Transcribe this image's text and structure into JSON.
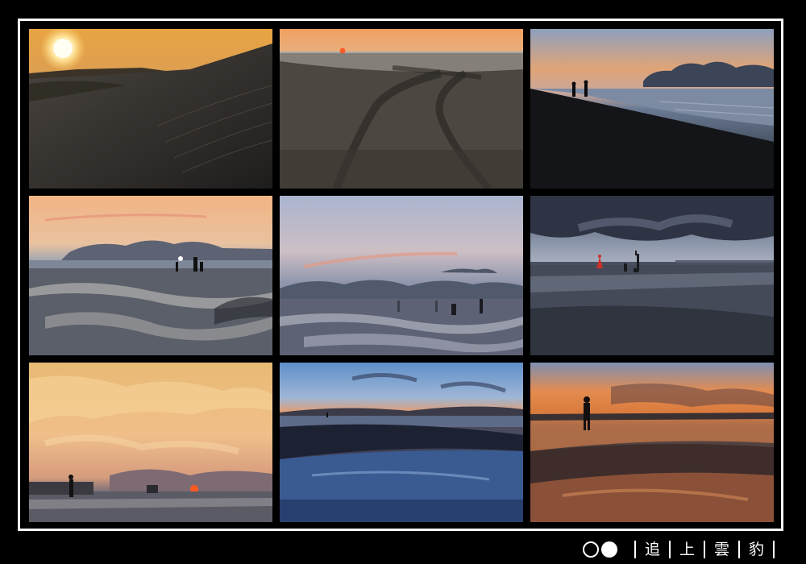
{
  "signature": {
    "chars": [
      "追",
      "上",
      "雲",
      "豹"
    ]
  },
  "photos": [
    {
      "subject": "sand-dune-sunset"
    },
    {
      "subject": "beach-tire-tracks-sunset"
    },
    {
      "subject": "couple-walking-beach-dusk"
    },
    {
      "subject": "tidal-flat-photographers"
    },
    {
      "subject": "blurred-figures-tidal-flat"
    },
    {
      "subject": "wedding-shoot-overcast-beach"
    },
    {
      "subject": "golden-clouds-sunset-figure"
    },
    {
      "subject": "blue-dusk-shoreline"
    },
    {
      "subject": "silhouette-orange-reflection"
    }
  ]
}
